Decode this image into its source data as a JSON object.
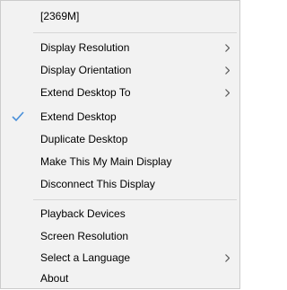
{
  "menu": {
    "header_label": "[2369M]",
    "items": [
      {
        "label": "Display Resolution",
        "submenu": true,
        "checked": false
      },
      {
        "label": "Display Orientation",
        "submenu": true,
        "checked": false
      },
      {
        "label": "Extend Desktop To",
        "submenu": true,
        "checked": false
      },
      {
        "label": "Extend Desktop",
        "submenu": false,
        "checked": true
      },
      {
        "label": "Duplicate Desktop",
        "submenu": false,
        "checked": false
      },
      {
        "label": "Make This My Main Display",
        "submenu": false,
        "checked": false
      },
      {
        "label": "Disconnect This Display",
        "submenu": false,
        "checked": false
      },
      {
        "label": "Playback Devices",
        "submenu": false,
        "checked": false
      },
      {
        "label": "Screen Resolution",
        "submenu": false,
        "checked": false
      },
      {
        "label": "Select a Language",
        "submenu": true,
        "checked": false
      },
      {
        "label": "About",
        "submenu": false,
        "checked": false
      }
    ]
  },
  "colors": {
    "background": "#f2f2f2",
    "border": "#cccccc",
    "separator": "#d6d6d6",
    "check": "#4a90d9",
    "arrow": "#5a5a5a"
  },
  "icons": {
    "check": "checkmark-icon",
    "submenu": "chevron-right-icon"
  }
}
